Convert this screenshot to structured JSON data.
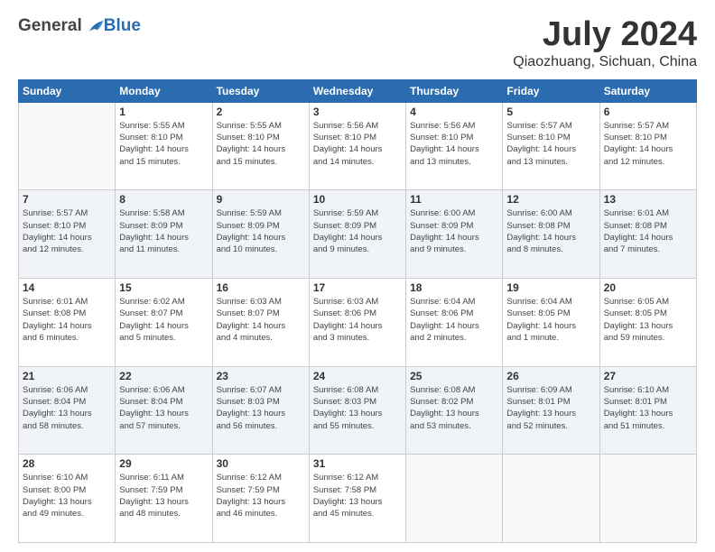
{
  "header": {
    "logo_general": "General",
    "logo_blue": "Blue",
    "month_title": "July 2024",
    "location": "Qiaozhuang, Sichuan, China"
  },
  "weekdays": [
    "Sunday",
    "Monday",
    "Tuesday",
    "Wednesday",
    "Thursday",
    "Friday",
    "Saturday"
  ],
  "weeks": [
    [
      {
        "day": "",
        "info": ""
      },
      {
        "day": "1",
        "info": "Sunrise: 5:55 AM\nSunset: 8:10 PM\nDaylight: 14 hours\nand 15 minutes."
      },
      {
        "day": "2",
        "info": "Sunrise: 5:55 AM\nSunset: 8:10 PM\nDaylight: 14 hours\nand 15 minutes."
      },
      {
        "day": "3",
        "info": "Sunrise: 5:56 AM\nSunset: 8:10 PM\nDaylight: 14 hours\nand 14 minutes."
      },
      {
        "day": "4",
        "info": "Sunrise: 5:56 AM\nSunset: 8:10 PM\nDaylight: 14 hours\nand 13 minutes."
      },
      {
        "day": "5",
        "info": "Sunrise: 5:57 AM\nSunset: 8:10 PM\nDaylight: 14 hours\nand 13 minutes."
      },
      {
        "day": "6",
        "info": "Sunrise: 5:57 AM\nSunset: 8:10 PM\nDaylight: 14 hours\nand 12 minutes."
      }
    ],
    [
      {
        "day": "7",
        "info": "Sunrise: 5:57 AM\nSunset: 8:10 PM\nDaylight: 14 hours\nand 12 minutes."
      },
      {
        "day": "8",
        "info": "Sunrise: 5:58 AM\nSunset: 8:09 PM\nDaylight: 14 hours\nand 11 minutes."
      },
      {
        "day": "9",
        "info": "Sunrise: 5:59 AM\nSunset: 8:09 PM\nDaylight: 14 hours\nand 10 minutes."
      },
      {
        "day": "10",
        "info": "Sunrise: 5:59 AM\nSunset: 8:09 PM\nDaylight: 14 hours\nand 9 minutes."
      },
      {
        "day": "11",
        "info": "Sunrise: 6:00 AM\nSunset: 8:09 PM\nDaylight: 14 hours\nand 9 minutes."
      },
      {
        "day": "12",
        "info": "Sunrise: 6:00 AM\nSunset: 8:08 PM\nDaylight: 14 hours\nand 8 minutes."
      },
      {
        "day": "13",
        "info": "Sunrise: 6:01 AM\nSunset: 8:08 PM\nDaylight: 14 hours\nand 7 minutes."
      }
    ],
    [
      {
        "day": "14",
        "info": "Sunrise: 6:01 AM\nSunset: 8:08 PM\nDaylight: 14 hours\nand 6 minutes."
      },
      {
        "day": "15",
        "info": "Sunrise: 6:02 AM\nSunset: 8:07 PM\nDaylight: 14 hours\nand 5 minutes."
      },
      {
        "day": "16",
        "info": "Sunrise: 6:03 AM\nSunset: 8:07 PM\nDaylight: 14 hours\nand 4 minutes."
      },
      {
        "day": "17",
        "info": "Sunrise: 6:03 AM\nSunset: 8:06 PM\nDaylight: 14 hours\nand 3 minutes."
      },
      {
        "day": "18",
        "info": "Sunrise: 6:04 AM\nSunset: 8:06 PM\nDaylight: 14 hours\nand 2 minutes."
      },
      {
        "day": "19",
        "info": "Sunrise: 6:04 AM\nSunset: 8:05 PM\nDaylight: 14 hours\nand 1 minute."
      },
      {
        "day": "20",
        "info": "Sunrise: 6:05 AM\nSunset: 8:05 PM\nDaylight: 13 hours\nand 59 minutes."
      }
    ],
    [
      {
        "day": "21",
        "info": "Sunrise: 6:06 AM\nSunset: 8:04 PM\nDaylight: 13 hours\nand 58 minutes."
      },
      {
        "day": "22",
        "info": "Sunrise: 6:06 AM\nSunset: 8:04 PM\nDaylight: 13 hours\nand 57 minutes."
      },
      {
        "day": "23",
        "info": "Sunrise: 6:07 AM\nSunset: 8:03 PM\nDaylight: 13 hours\nand 56 minutes."
      },
      {
        "day": "24",
        "info": "Sunrise: 6:08 AM\nSunset: 8:03 PM\nDaylight: 13 hours\nand 55 minutes."
      },
      {
        "day": "25",
        "info": "Sunrise: 6:08 AM\nSunset: 8:02 PM\nDaylight: 13 hours\nand 53 minutes."
      },
      {
        "day": "26",
        "info": "Sunrise: 6:09 AM\nSunset: 8:01 PM\nDaylight: 13 hours\nand 52 minutes."
      },
      {
        "day": "27",
        "info": "Sunrise: 6:10 AM\nSunset: 8:01 PM\nDaylight: 13 hours\nand 51 minutes."
      }
    ],
    [
      {
        "day": "28",
        "info": "Sunrise: 6:10 AM\nSunset: 8:00 PM\nDaylight: 13 hours\nand 49 minutes."
      },
      {
        "day": "29",
        "info": "Sunrise: 6:11 AM\nSunset: 7:59 PM\nDaylight: 13 hours\nand 48 minutes."
      },
      {
        "day": "30",
        "info": "Sunrise: 6:12 AM\nSunset: 7:59 PM\nDaylight: 13 hours\nand 46 minutes."
      },
      {
        "day": "31",
        "info": "Sunrise: 6:12 AM\nSunset: 7:58 PM\nDaylight: 13 hours\nand 45 minutes."
      },
      {
        "day": "",
        "info": ""
      },
      {
        "day": "",
        "info": ""
      },
      {
        "day": "",
        "info": ""
      }
    ]
  ]
}
